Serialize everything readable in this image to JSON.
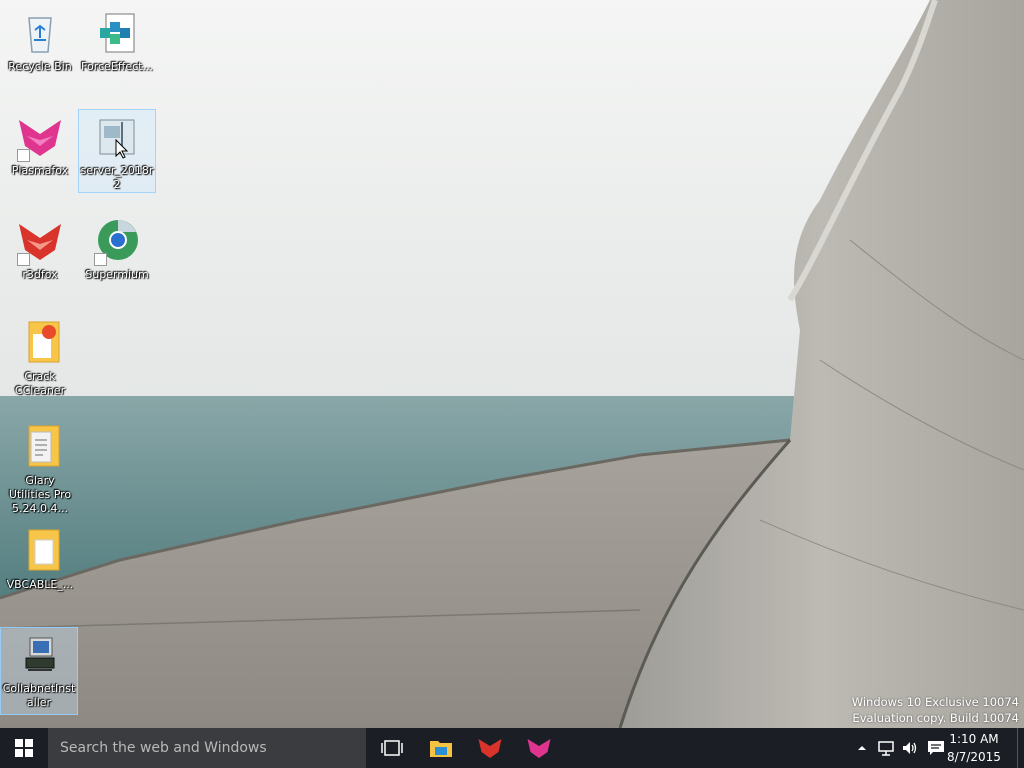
{
  "desktop": {
    "icons": [
      {
        "label": "Recycle Bin"
      },
      {
        "label": "ForceEffect..."
      },
      {
        "label": "Plasmafox"
      },
      {
        "label": "server_2018r2"
      },
      {
        "label": "r3dfox"
      },
      {
        "label": "Supermium"
      },
      {
        "label": "Crack CCleaner"
      },
      {
        "label": "Glary Utilities Pro 5.24.0.4..."
      },
      {
        "label": "VBCABLE_..."
      },
      {
        "label": "CollabnetInstaller"
      }
    ]
  },
  "watermark": {
    "line1": "Windows 10 Exclusive 10074",
    "line2": "Evaluation copy. Build 10074"
  },
  "taskbar": {
    "search_placeholder": "Search the web and Windows",
    "clock_time": "1:10 AM",
    "clock_date": "8/7/2015",
    "pinned": [
      "task-view-icon",
      "file-explorer-icon",
      "r3dfox-icon",
      "plasmafox-icon"
    ]
  },
  "colors": {
    "taskbar_bg": "#1b1f25",
    "search_bg": "#3a3c3f",
    "accent_pink": "#e0358f",
    "accent_red": "#d9342b"
  }
}
